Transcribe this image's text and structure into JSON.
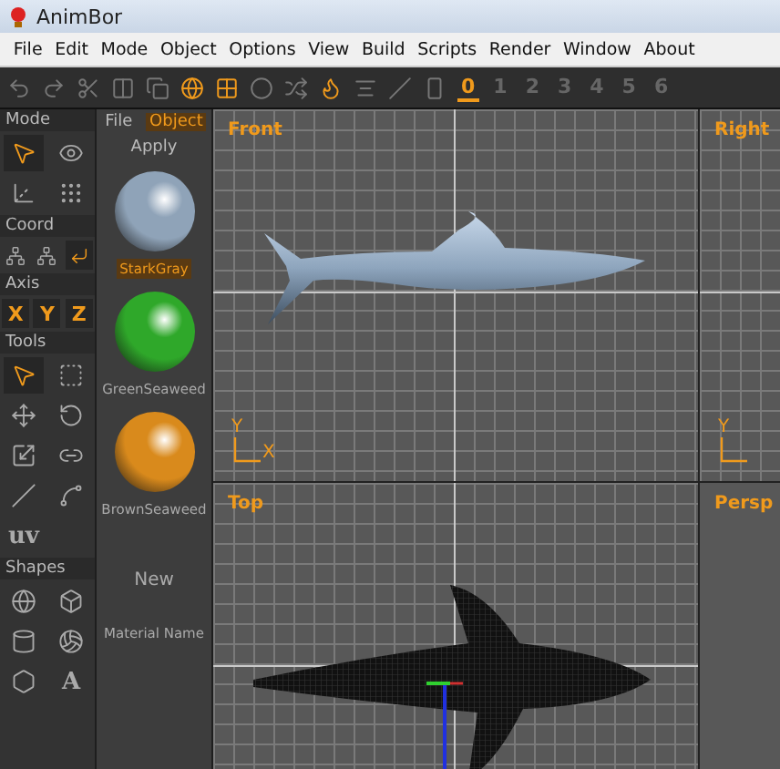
{
  "window": {
    "title": "AnimBor"
  },
  "menu": [
    "File",
    "Edit",
    "Mode",
    "Object",
    "Options",
    "View",
    "Build",
    "Scripts",
    "Render",
    "Window",
    "About"
  ],
  "toolbar": {
    "tools": [
      {
        "kind": "undo",
        "active": false
      },
      {
        "kind": "redo",
        "active": false
      },
      {
        "kind": "cut",
        "active": false
      },
      {
        "kind": "split",
        "active": false
      },
      {
        "kind": "copy",
        "active": false
      },
      {
        "kind": "sphere",
        "active": true
      },
      {
        "kind": "quad",
        "active": true
      },
      {
        "kind": "ring",
        "active": false
      },
      {
        "kind": "scatter",
        "active": false
      },
      {
        "kind": "flame",
        "active": true
      },
      {
        "kind": "align",
        "active": false
      },
      {
        "kind": "angle",
        "active": false
      },
      {
        "kind": "bar",
        "active": false
      }
    ],
    "layers": [
      {
        "label": "0",
        "selected": true
      },
      {
        "label": "1",
        "selected": false
      },
      {
        "label": "2",
        "selected": false
      },
      {
        "label": "3",
        "selected": false
      },
      {
        "label": "4",
        "selected": false
      },
      {
        "label": "5",
        "selected": false
      },
      {
        "label": "6",
        "selected": false
      }
    ]
  },
  "tool_panel": [
    {
      "title": "Mode",
      "tools": [
        {
          "kind": "pointer",
          "selected": true
        },
        {
          "kind": "eye",
          "selected": false
        },
        {
          "kind": "axes",
          "selected": false
        },
        {
          "kind": "dots",
          "selected": false
        }
      ]
    },
    {
      "title": "Coord",
      "tools": [
        {
          "kind": "tripod",
          "selected": false
        },
        {
          "kind": "tripod",
          "selected": false
        },
        {
          "kind": "corner",
          "selected": true
        }
      ]
    },
    {
      "title": "Axis",
      "tools": [
        {
          "kind": "letter",
          "label": "X",
          "selected": true
        },
        {
          "kind": "letter",
          "label": "Y",
          "selected": true
        },
        {
          "kind": "letter",
          "label": "Z",
          "selected": true
        }
      ]
    },
    {
      "title": "Tools",
      "tools": [
        {
          "kind": "pointer",
          "selected": true
        },
        {
          "kind": "marquee",
          "selected": false
        },
        {
          "kind": "move",
          "selected": false
        },
        {
          "kind": "rotate",
          "selected": false
        },
        {
          "kind": "scale",
          "selected": false
        },
        {
          "kind": "link",
          "selected": false
        },
        {
          "kind": "line",
          "selected": false
        },
        {
          "kind": "curve",
          "selected": false
        },
        {
          "kind": "text",
          "label": "uv",
          "selected": false
        }
      ]
    },
    {
      "title": "Shapes",
      "tools": [
        {
          "kind": "globe",
          "selected": false
        },
        {
          "kind": "cube",
          "selected": false
        },
        {
          "kind": "cylinder",
          "selected": false
        },
        {
          "kind": "ball",
          "selected": false
        },
        {
          "kind": "hexagon",
          "selected": false
        },
        {
          "kind": "text",
          "label": "A",
          "selected": false
        }
      ]
    }
  ],
  "materials": {
    "tabs": [
      {
        "label": "File",
        "selected": false
      },
      {
        "label": "Object",
        "selected": true
      }
    ],
    "apply": "Apply",
    "items": [
      {
        "name": "StarkGray",
        "color": "#8fa3b8",
        "selected": true
      },
      {
        "name": "GreenSeaweed",
        "color": "#2fa82a",
        "selected": false
      },
      {
        "name": "BrownSeaweed",
        "color": "#d98a1c",
        "selected": false
      }
    ],
    "new": "New",
    "name_label": "Material Name"
  },
  "viewports": [
    {
      "label": "Front",
      "grid": true,
      "kind": "side",
      "axes": [
        "Y",
        "X"
      ]
    },
    {
      "label": "Right",
      "grid": true,
      "kind": "empty",
      "axes": [
        "Y"
      ]
    },
    {
      "label": "Top",
      "grid": true,
      "kind": "top"
    },
    {
      "label": "Persp",
      "grid": false,
      "kind": "empty"
    }
  ]
}
